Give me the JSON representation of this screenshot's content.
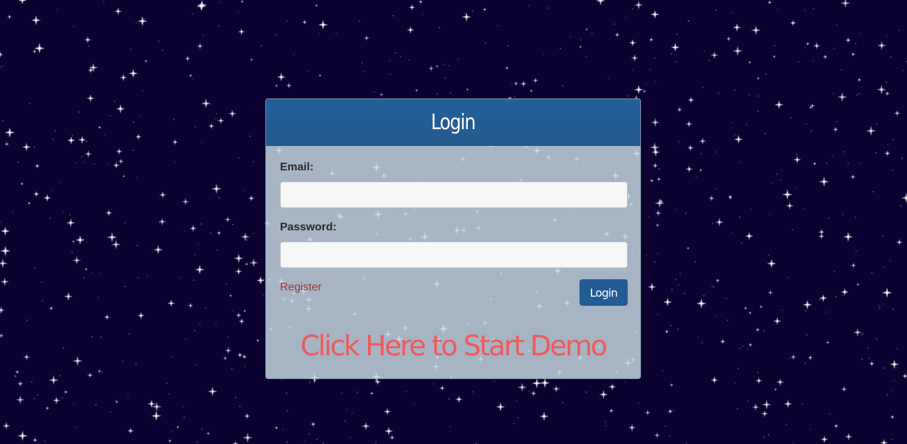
{
  "background": {
    "color": "#0b0232",
    "pattern": "starfield"
  },
  "login": {
    "title": "Login",
    "email_label": "Email:",
    "email_value": "",
    "password_label": "Password:",
    "password_value": "",
    "register_label": "Register",
    "login_button_label": "Login",
    "demo_link_label": "Click Here to Start Demo"
  },
  "colors": {
    "header": "#265a8d",
    "button": "#235b92",
    "register_link": "#a93435",
    "demo_link": "#ef5a5b"
  }
}
